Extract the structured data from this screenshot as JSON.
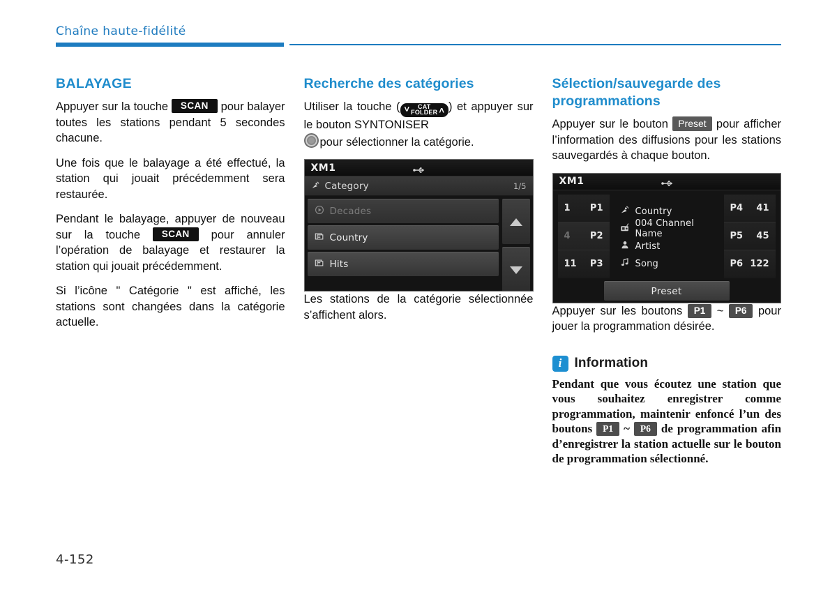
{
  "header": {
    "chapter_title": "Chaîne haute-fidélité",
    "accent_color": "#1d7cc0"
  },
  "folio": "4-152",
  "columns": {
    "left": {
      "title": "BALAYAGE",
      "paragraphs": {
        "p1_a": "Appuyer sur la touche",
        "p1_key": "SCAN",
        "p1_b": "pour balayer toutes les stations pendant 5 secondes chacune.",
        "p2": "Une fois que le balayage a été effectué, la station qui jouait précédemment sera restaurée.",
        "p3_a": "Pendant le balayage, appuyer de nouveau sur la touche",
        "p3_key": "SCAN",
        "p3_b": "pour annuler l’opération de balayage et restaurer la station qui jouait précédemment.",
        "p4": "Si l’icône \" Catégorie \" est affiché, les stations sont changées dans la catégorie actuelle."
      }
    },
    "middle": {
      "title": "Recherche des catégories",
      "paragraphs": {
        "p1_a": "Utiliser la touche (",
        "p1_key_line1": "CAT",
        "p1_key_line2": "FOLDER",
        "p1_key_chevron_down": "˅",
        "p1_key_chevron_up": "˄",
        "p1_b": ") et appuyer sur le bouton SYNTONISER",
        "p1_c": "pour sélectionner la catégorie.",
        "p2": "Les stations de la catégorie sélectionnée s’affichent alors."
      },
      "screen": {
        "source": "XM1",
        "usb_icon": "usb-icon",
        "category_bar": {
          "icon": "satellite-dish-icon",
          "label": "Category",
          "page_indicator": "1/5"
        },
        "items": [
          {
            "icon": "play-circle-icon",
            "label": "Decades",
            "dimmed": true
          },
          {
            "icon": "folder-icon",
            "label": "Country",
            "dimmed": false
          },
          {
            "icon": "folder-icon",
            "label": "Hits",
            "dimmed": false
          }
        ],
        "scroll_up": "scroll-up-arrow",
        "scroll_down": "scroll-down-arrow",
        "back_button": "back-arrow-icon"
      }
    },
    "right": {
      "title": "Sélection/sauvegarde des programmations",
      "paragraphs": {
        "p1_a": "Appuyer sur le bouton",
        "p1_key": "Preset",
        "p1_b": "pour afficher l’information des diffusions pour les stations sauvegardés à chaque bouton.",
        "p2_a": "Appuyer sur les boutons",
        "p2_key1": "P1",
        "p2_tilde": "~",
        "p2_key2": "P6",
        "p2_b": "pour jouer la programmation désirée."
      },
      "screen": {
        "source": "XM1",
        "usb_icon": "usb-icon",
        "left_presets": [
          {
            "channel": "1",
            "preset": "P1",
            "dimmed": false
          },
          {
            "channel": "4",
            "preset": "P2",
            "dimmed": true
          },
          {
            "channel": "11",
            "preset": "P3",
            "dimmed": false
          }
        ],
        "right_presets": [
          {
            "preset": "P4",
            "channel": "41",
            "dimmed": false
          },
          {
            "preset": "P5",
            "channel": "45",
            "dimmed": false
          },
          {
            "preset": "P6",
            "channel": "122",
            "dimmed": false
          }
        ],
        "info_rows": [
          {
            "icon": "satellite-dish-icon",
            "text": "Country"
          },
          {
            "icon": "radio-icon",
            "text": "004 Channel Name"
          },
          {
            "icon": "person-icon",
            "text": "Artist"
          },
          {
            "icon": "music-note-icon",
            "text": "Song"
          }
        ],
        "preset_button": "Preset"
      },
      "information": {
        "icon": "i",
        "title": "Information",
        "text_a": "Pendant que vous écoutez une station que vous souhaitez enregistrer comme programmation, maintenir enfoncé l’un des boutons",
        "key1": "P1",
        "tilde": "~",
        "key2": "P6",
        "text_b": "de programmation afin d’enregistrer la station actuelle sur le bouton de programmation sélectionné."
      }
    }
  }
}
